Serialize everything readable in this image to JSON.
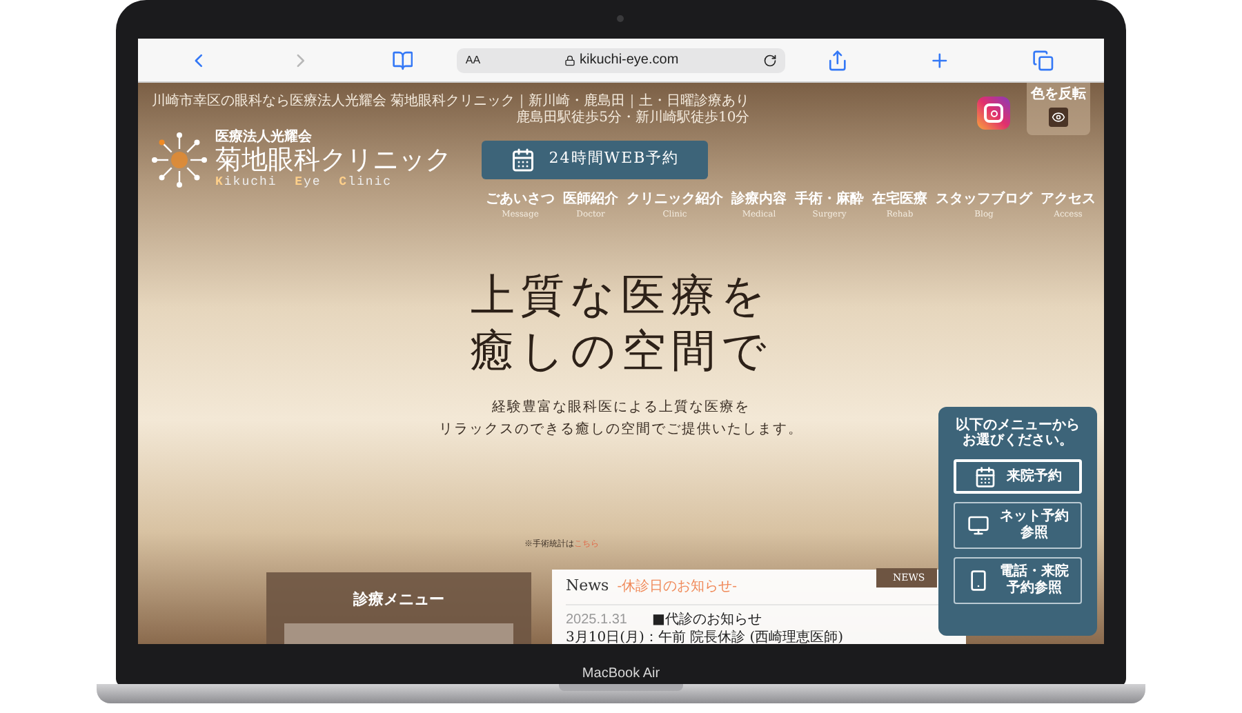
{
  "browser": {
    "text_size": "AA",
    "address": "kikuchi-eye.com"
  },
  "header": {
    "tagline": "川崎市幸区の眼科なら医療法人光耀会 菊地眼科クリニック｜新川崎・鹿島田｜土・日曜診療あり",
    "access": "鹿島田駅徒歩5分・新川崎駅徒歩10分",
    "logo": {
      "org": "医療法人光耀会",
      "name": "菊地眼科クリニック",
      "roman": [
        "Kikuchi",
        "Eye",
        "Clinic"
      ]
    },
    "web_reserve": "24時間WEB予約",
    "color_invert": "色を反転"
  },
  "nav": [
    {
      "label": "ごあいさつ",
      "sub": "Message"
    },
    {
      "label": "医師紹介",
      "sub": "Doctor"
    },
    {
      "label": "クリニック紹介",
      "sub": "Clinic"
    },
    {
      "label": "診療内容",
      "sub": "Medical"
    },
    {
      "label": "手術・麻酔",
      "sub": "Surgery"
    },
    {
      "label": "在宅医療",
      "sub": "Rehab"
    },
    {
      "label": "スタッフブログ",
      "sub": "Blog"
    },
    {
      "label": "アクセス",
      "sub": "Access"
    }
  ],
  "hero": {
    "headline": [
      "上質な医療を",
      "癒しの空間で"
    ],
    "lead": [
      "経験豊富な眼科医による上質な医療を",
      "リラックスのできる癒しの空間でご提供いたします。"
    ]
  },
  "note": {
    "text": "※手術統計は",
    "link": "こちら"
  },
  "menu_panel": {
    "title": "診療メニュー"
  },
  "news": {
    "tab": "NEWS",
    "title": "News",
    "subtitle": "-休診日のお知らせ-",
    "date": "2025.1.31",
    "headline": "■代診のお知らせ",
    "detail": "3月10日(月)：午前 院長休診 (西崎理恵医師)"
  },
  "reserve_panel": {
    "prompt": [
      "以下のメニューから",
      "お選びください。"
    ],
    "buttons": [
      {
        "kind": "calendar",
        "lines": [
          "来院予約"
        ],
        "selected": true
      },
      {
        "kind": "monitor",
        "lines": [
          "ネット予約",
          "参照"
        ],
        "selected": false
      },
      {
        "kind": "phone",
        "lines": [
          "電話・来院",
          "予約参照"
        ],
        "selected": false
      }
    ]
  },
  "laptop": {
    "model": "MacBook Air"
  }
}
